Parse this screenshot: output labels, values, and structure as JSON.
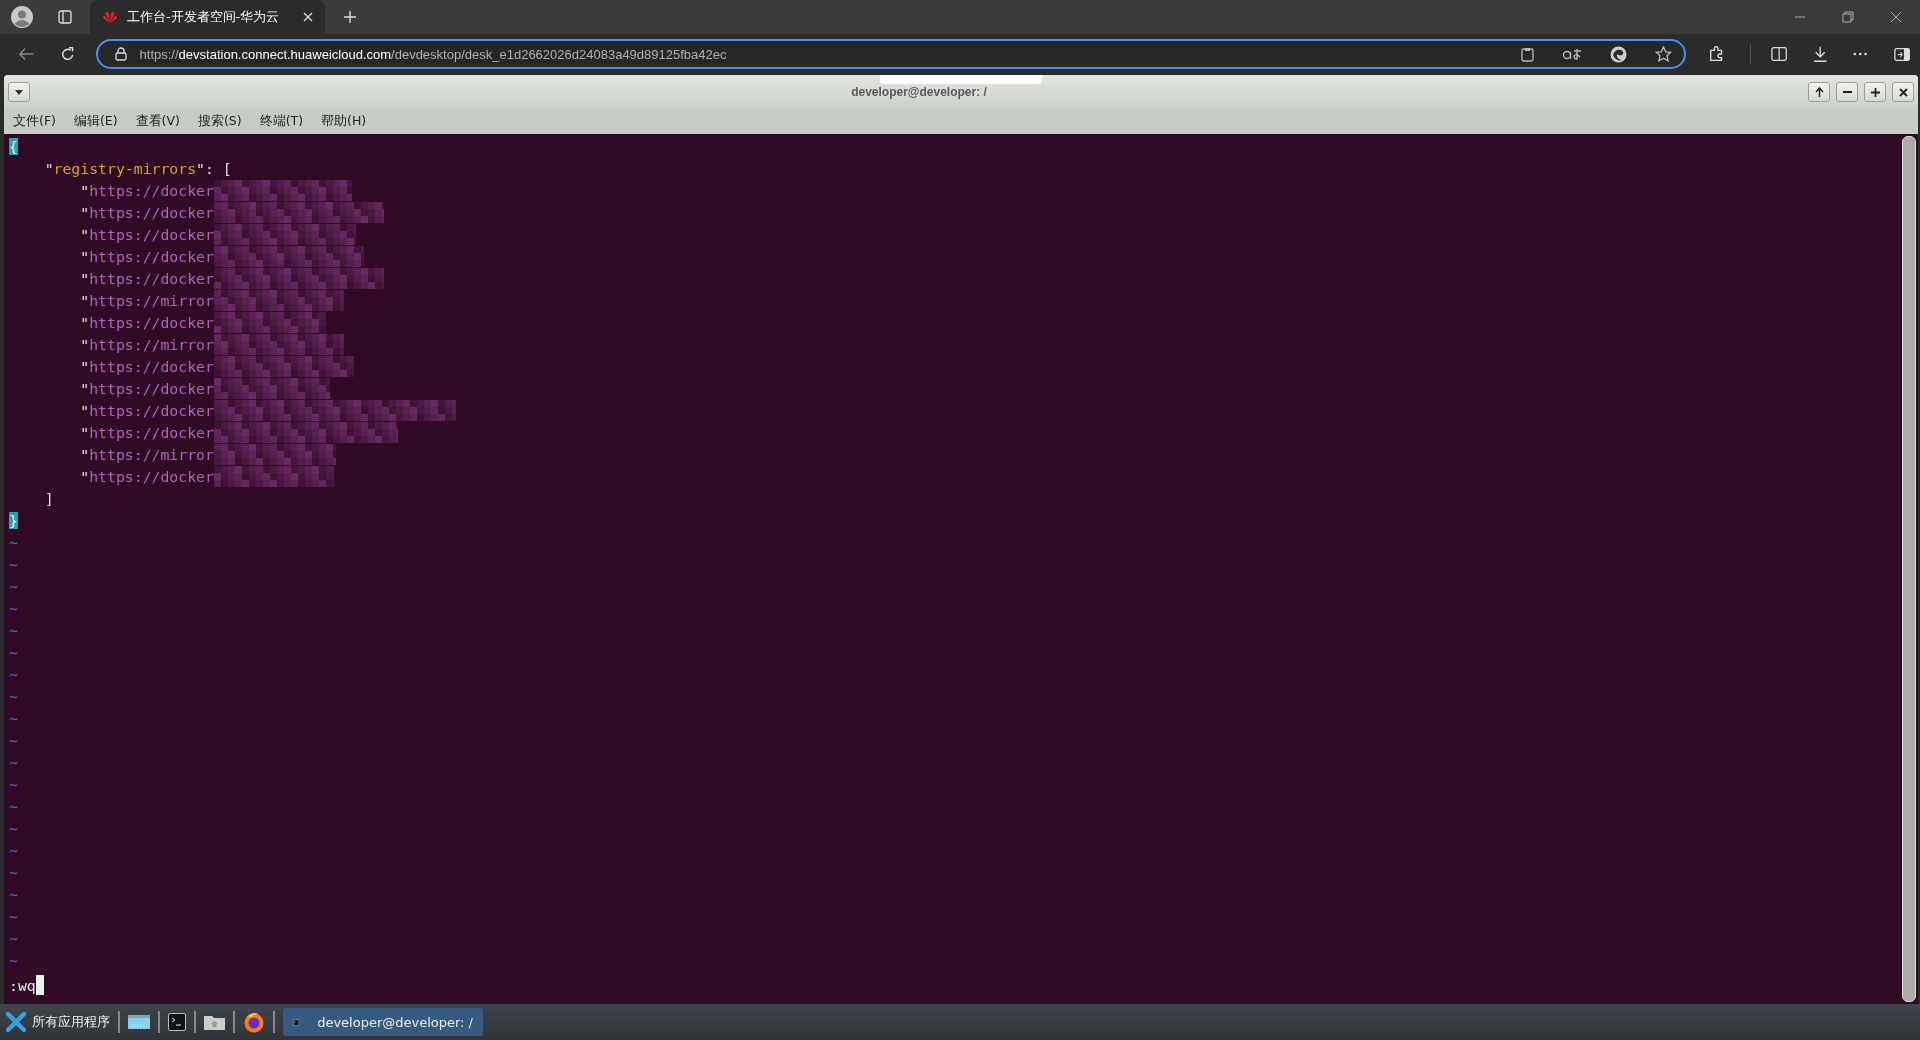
{
  "browser": {
    "tab": {
      "title": "工作台-开发者空间-华为云",
      "selected": true
    },
    "address": {
      "scheme": "https://",
      "host": "devstation.connect.huaweicloud.com",
      "path": "/devdesktop/desk_e1d2662026d24083a49d89125fba42ec"
    }
  },
  "terminal": {
    "title": "developer@developer: /",
    "menu": [
      "文件(F)",
      "编辑(E)",
      "查看(V)",
      "搜索(S)",
      "终端(T)",
      "帮助(H)"
    ],
    "lines": [
      {
        "kind": "object",
        "segments": [
          {
            "kind": "matched",
            "text": "{"
          }
        ]
      },
      {
        "kind": "member",
        "segments": [
          {
            "kind": "punct",
            "text": "\""
          },
          {
            "kind": "key",
            "text": "registry-mirrors"
          },
          {
            "kind": "punct",
            "text": "\": ["
          }
        ]
      },
      {
        "kind": "item",
        "segments": [
          {
            "kind": "punct",
            "text": "\""
          },
          {
            "kind": "string",
            "text": "https://docker"
          }
        ],
        "blurred": true
      },
      {
        "kind": "item",
        "segments": [
          {
            "kind": "punct",
            "text": "\""
          },
          {
            "kind": "string",
            "text": "https://docker"
          }
        ],
        "blurred": true
      },
      {
        "kind": "item",
        "segments": [
          {
            "kind": "punct",
            "text": "\""
          },
          {
            "kind": "string",
            "text": "https://docker"
          }
        ],
        "blurred": true
      },
      {
        "kind": "item",
        "segments": [
          {
            "kind": "punct",
            "text": "\""
          },
          {
            "kind": "string",
            "text": "https://docker"
          }
        ],
        "blurred": true
      },
      {
        "kind": "item",
        "segments": [
          {
            "kind": "punct",
            "text": "\""
          },
          {
            "kind": "string",
            "text": "https://docker"
          }
        ],
        "blurred": true
      },
      {
        "kind": "item",
        "segments": [
          {
            "kind": "punct",
            "text": "\""
          },
          {
            "kind": "string",
            "text": "https://mirror"
          }
        ],
        "blurred": true
      },
      {
        "kind": "item",
        "segments": [
          {
            "kind": "punct",
            "text": "\""
          },
          {
            "kind": "string",
            "text": "https://docker"
          }
        ],
        "blurred": true
      },
      {
        "kind": "item",
        "segments": [
          {
            "kind": "punct",
            "text": "\""
          },
          {
            "kind": "string",
            "text": "https://mirror"
          }
        ],
        "blurred": true
      },
      {
        "kind": "item",
        "segments": [
          {
            "kind": "punct",
            "text": "\""
          },
          {
            "kind": "string",
            "text": "https://docker"
          }
        ],
        "blurred": true
      },
      {
        "kind": "item",
        "segments": [
          {
            "kind": "punct",
            "text": "\""
          },
          {
            "kind": "string",
            "text": "https://docker"
          }
        ],
        "blurred": true
      },
      {
        "kind": "item",
        "segments": [
          {
            "kind": "punct",
            "text": "\""
          },
          {
            "kind": "string",
            "text": "https://docker"
          }
        ],
        "blurred": true
      },
      {
        "kind": "item",
        "segments": [
          {
            "kind": "punct",
            "text": "\""
          },
          {
            "kind": "string",
            "text": "https://docker"
          }
        ],
        "blurred": true
      },
      {
        "kind": "item",
        "segments": [
          {
            "kind": "punct",
            "text": "\""
          },
          {
            "kind": "string",
            "text": "https://mirror"
          }
        ],
        "blurred": true
      },
      {
        "kind": "item",
        "segments": [
          {
            "kind": "punct",
            "text": "\""
          },
          {
            "kind": "string",
            "text": "https://docker"
          }
        ],
        "blurred": true
      },
      {
        "kind": "member",
        "segments": [
          {
            "kind": "punct",
            "text": "]"
          }
        ]
      },
      {
        "kind": "object",
        "segments": [
          {
            "kind": "matched",
            "text": "}"
          }
        ]
      }
    ],
    "tildes": [
      "~",
      "~",
      "~",
      "~",
      "~",
      "~",
      "~",
      "~",
      "~",
      "~",
      "~",
      "~",
      "~",
      "~",
      "~",
      "~",
      "~",
      "~",
      "~",
      "~"
    ],
    "command": ":wq"
  },
  "taskbar": {
    "menu": "所有应用程序",
    "task": {
      "title": "developer@developer: /",
      "selected": true
    }
  }
}
